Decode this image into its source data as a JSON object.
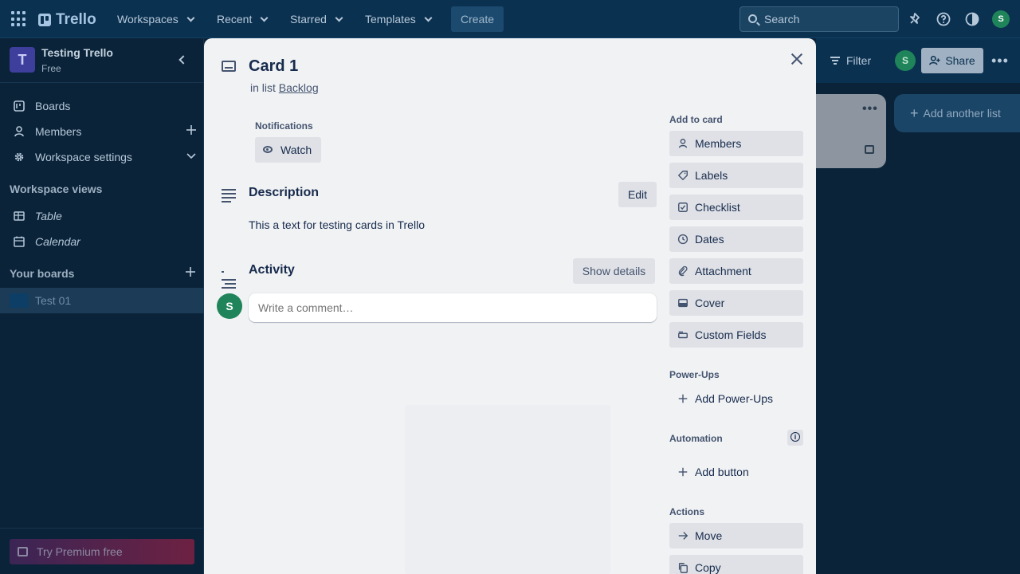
{
  "topnav": {
    "logo": "Trello",
    "menus": [
      {
        "label": "Workspaces"
      },
      {
        "label": "Recent"
      },
      {
        "label": "Starred"
      },
      {
        "label": "Templates"
      }
    ],
    "create_label": "Create",
    "search_placeholder": "Search",
    "avatar_initial": "S"
  },
  "sidebar": {
    "workspace_initial": "T",
    "workspace_name": "Testing Trello",
    "workspace_plan": "Free",
    "items": [
      {
        "label": "Boards"
      },
      {
        "label": "Members"
      },
      {
        "label": "Workspace settings"
      }
    ],
    "views_heading": "Workspace views",
    "views": [
      {
        "label": "Table"
      },
      {
        "label": "Calendar"
      }
    ],
    "boards_heading": "Your boards",
    "boards": [
      {
        "label": "Test 01"
      }
    ],
    "premium_label": "Try Premium free"
  },
  "board_header": {
    "filter_label": "Filter",
    "member_initial": "S",
    "share_label": "Share",
    "add_list_label": "Add another list"
  },
  "card": {
    "title": "Card 1",
    "in_list_prefix": "in list",
    "list_name": "Backlog",
    "notifications_label": "Notifications",
    "watch_label": "Watch",
    "description_heading": "Description",
    "edit_label": "Edit",
    "description_text": "This a text for testing cards in Trello",
    "activity_heading": "Activity",
    "show_details_label": "Show details",
    "comment_avatar_initial": "S",
    "comment_placeholder": "Write a comment…"
  },
  "side": {
    "add_to_card_heading": "Add to card",
    "add_to_card": [
      {
        "label": "Members",
        "icon": "person-icon"
      },
      {
        "label": "Labels",
        "icon": "tag-icon"
      },
      {
        "label": "Checklist",
        "icon": "checklist-icon"
      },
      {
        "label": "Dates",
        "icon": "clock-icon"
      },
      {
        "label": "Attachment",
        "icon": "paperclip-icon"
      },
      {
        "label": "Cover",
        "icon": "cover-icon"
      },
      {
        "label": "Custom Fields",
        "icon": "custom-fields-icon"
      }
    ],
    "powerups_heading": "Power-Ups",
    "add_powerups_label": "Add Power-Ups",
    "automation_heading": "Automation",
    "add_button_label": "Add button",
    "actions_heading": "Actions",
    "actions": [
      {
        "label": "Move",
        "icon": "arrow-right-icon"
      },
      {
        "label": "Copy",
        "icon": "copy-icon"
      }
    ]
  }
}
